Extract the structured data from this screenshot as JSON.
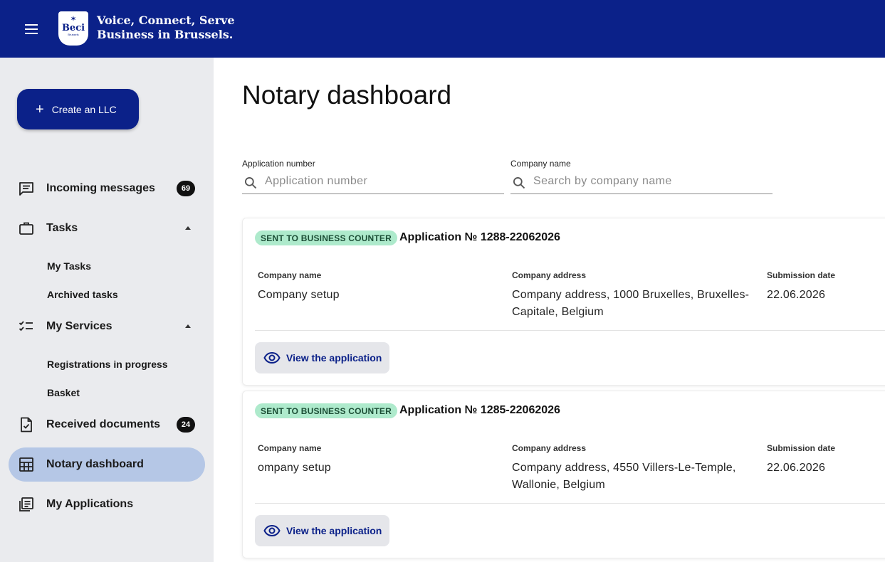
{
  "header": {
    "logo_text": "Beci",
    "logo_subtext": "Brussels",
    "tagline_line1": "Voice, Connect, Serve",
    "tagline_line2": "Business in Brussels."
  },
  "sidebar": {
    "create_button": "Create an LLC",
    "items": [
      {
        "label": "Incoming messages",
        "icon": "chat-icon",
        "badge": "69"
      },
      {
        "label": "Tasks",
        "icon": "briefcase-icon",
        "expanded": true,
        "children": [
          "My Tasks",
          "Archived tasks"
        ]
      },
      {
        "label": "My Services",
        "icon": "checklist-icon",
        "expanded": true,
        "children": [
          "Registrations in progress",
          "Basket"
        ]
      },
      {
        "label": "Received documents",
        "icon": "document-check-icon",
        "badge": "24"
      },
      {
        "label": "Notary dashboard",
        "icon": "table-icon",
        "active": true
      },
      {
        "label": "My Applications",
        "icon": "applications-icon"
      }
    ]
  },
  "main": {
    "title": "Notary dashboard",
    "filters": {
      "application_number_label": "Application number",
      "application_number_placeholder": "Application number",
      "application_number_value": "",
      "company_name_label": "Company name",
      "company_name_placeholder": "Search by company name",
      "company_name_value": ""
    },
    "applications": [
      {
        "status": "SENT TO BUSINESS COUNTER",
        "number": "Application № 1288-22062026",
        "company_name_label": "Company name",
        "company_name": "Company setup",
        "company_address_label": "Company address",
        "company_address": "Company address, 1000 Bruxelles, Bruxelles-Capitale, Belgium",
        "submission_date_label": "Submission date",
        "submission_date": "22.06.2026",
        "action": "View the application"
      },
      {
        "status": "SENT TO BUSINESS COUNTER",
        "number": "Application № 1285-22062026",
        "company_name_label": "Company name",
        "company_name": "ompany setup",
        "company_address_label": "Company address",
        "company_address": "Company address, 4550 Villers-Le-Temple, Wallonie, Belgium",
        "submission_date_label": "Submission date",
        "submission_date": "22.06.2026",
        "action": "View the application"
      }
    ]
  },
  "colors": {
    "brand_navy": "#0b2189",
    "sidebar_bg": "#eaebee",
    "active_item": "#b5c7e6",
    "status_badge_bg": "#aeeacc",
    "count_badge_bg": "#111111"
  }
}
